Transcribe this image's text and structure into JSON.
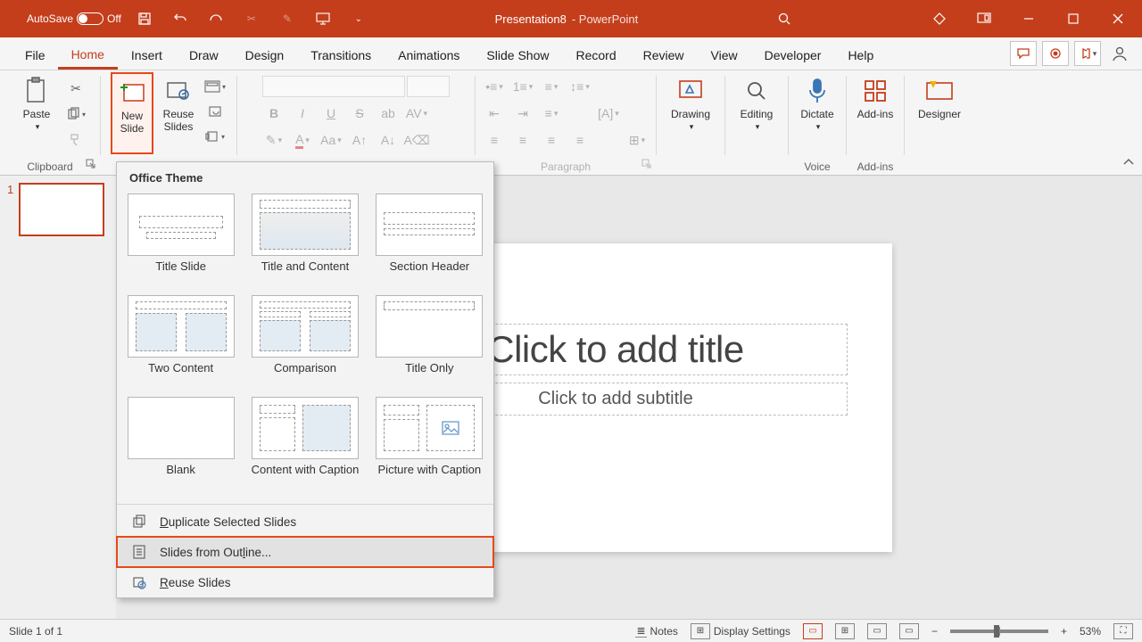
{
  "titlebar": {
    "autosave_label": "AutoSave",
    "autosave_state": "Off",
    "doc_name": "Presentation8",
    "app_suffix": " - PowerPoint"
  },
  "tabs": {
    "file": "File",
    "items": [
      "Home",
      "Insert",
      "Draw",
      "Design",
      "Transitions",
      "Animations",
      "Slide Show",
      "Record",
      "Review",
      "View",
      "Developer",
      "Help"
    ],
    "active": "Home"
  },
  "ribbon": {
    "clipboard": {
      "paste": "Paste",
      "label": "Clipboard"
    },
    "slides": {
      "new_slide": "New\nSlide",
      "reuse": "Reuse\nSlides"
    },
    "paragraph": {
      "label": "Paragraph"
    },
    "drawing": "Drawing",
    "editing": "Editing",
    "dictate": "Dictate",
    "voice": "Voice",
    "addins": "Add-ins",
    "addins_label": "Add-ins",
    "designer": "Designer"
  },
  "dropdown": {
    "heading": "Office Theme",
    "layouts": [
      "Title Slide",
      "Title and Content",
      "Section Header",
      "Two Content",
      "Comparison",
      "Title Only",
      "Blank",
      "Content with Caption",
      "Picture with Caption"
    ],
    "duplicate": "Duplicate Selected Slides",
    "outline_prefix": "Slides from Out",
    "outline_char": "l",
    "outline_suffix": "ine...",
    "reuse_char": "R",
    "reuse_suffix": "euse Slides"
  },
  "slide": {
    "thumb_num": "1",
    "title_placeholder": "Click to add title",
    "subtitle_placeholder": "Click to add subtitle"
  },
  "statusbar": {
    "slide_info": "Slide 1 of 1",
    "notes": "Notes",
    "display": "Display Settings",
    "zoom": "53%"
  }
}
